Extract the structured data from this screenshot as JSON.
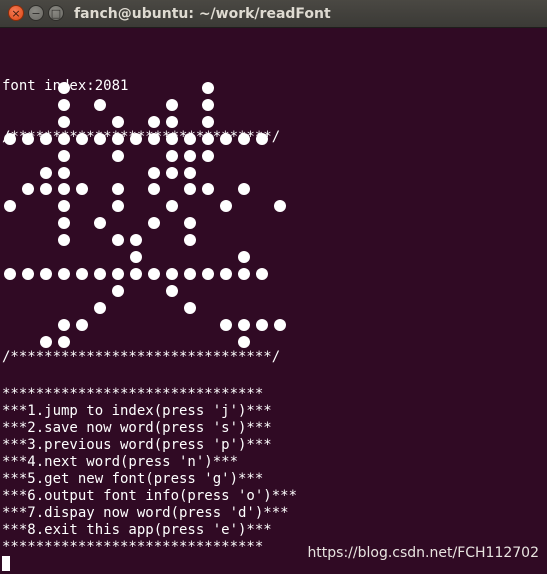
{
  "window": {
    "title": "fanch@ubuntu: ~/work/readFont",
    "close_glyph": "×",
    "minimize_glyph": "−",
    "maximize_glyph": "□"
  },
  "terminal": {
    "index_line": "font index:2081",
    "border_top": "/*******************************/",
    "border_bottom": "/*******************************/",
    "glyph_rows": [
      "   #       #   ",
      "   # #   # #   ",
      "   #  # ## #   ",
      "###############",
      "   #  #  ###   ",
      "  ##    ###    ",
      " #### # # ## # ",
      "#  #  #  #  #  #",
      "   # #  # #    ",
      "   #  ##  #    ",
      "       #     #  ",
      "###############",
      "      #  #     ",
      "     #    #    ",
      "   ##       ####",
      "  ##         # "
    ],
    "menu": [
      "*******************************",
      "***1.jump to index(press 'j')***",
      "***2.save now word(press 's')***",
      "***3.previous word(press 'p')***",
      "***4.next word(press 'n')***",
      "***5.get new font(press 'g')***",
      "***6.output font info(press 'o')***",
      "***7.dispay now word(press 'd')***",
      "***8.exit this app(press 'e')***",
      "*******************************"
    ]
  },
  "watermark": "https://blog.csdn.net/FCH112702"
}
